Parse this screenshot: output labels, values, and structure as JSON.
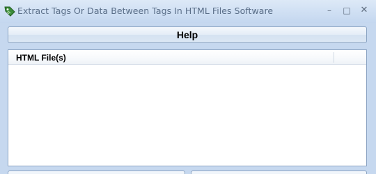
{
  "window": {
    "title": "Extract Tags Or Data Between Tags In HTML Files Software",
    "icon": "app-tag-icon",
    "controls": {
      "minimize": "–",
      "maximize": "□",
      "close": "✕"
    }
  },
  "toolbar": {
    "help_label": "Help"
  },
  "file_list": {
    "columns": [
      "HTML File(s)"
    ],
    "rows": []
  },
  "colors": {
    "window_background": "#c6d8ef",
    "border": "#8aa3c2",
    "title_text": "#5a6e88"
  }
}
